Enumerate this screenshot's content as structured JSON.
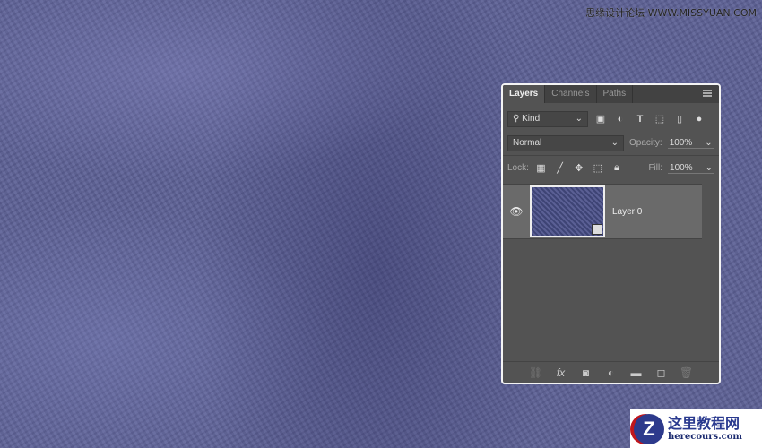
{
  "watermark": "思缘设计论坛 WWW.MISSYUAN.COM",
  "panel": {
    "tabs": [
      {
        "label": "Layers"
      },
      {
        "label": "Channels"
      },
      {
        "label": "Paths"
      }
    ],
    "filter": {
      "label": "Kind"
    },
    "blend_mode": "Normal",
    "opacity_label": "Opacity:",
    "opacity": "100%",
    "lock_label": "Lock:",
    "fill_label": "Fill:",
    "fill": "100%",
    "layers": [
      {
        "name": "Layer 0"
      }
    ]
  },
  "logo": {
    "title": "这里教程网",
    "url": "herecours.com",
    "letter": "Z"
  }
}
